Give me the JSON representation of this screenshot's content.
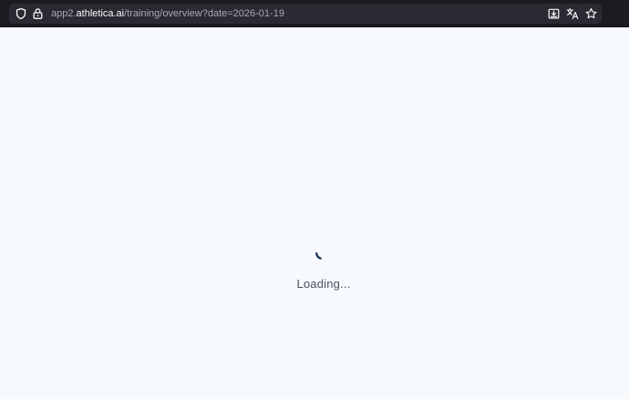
{
  "browser": {
    "url": {
      "prefix": "app2.",
      "host_bold": "athletica.ai",
      "path": "/training/overview?date=2026-01-19"
    },
    "icons": {
      "left": [
        "shield-icon",
        "lock-icon"
      ],
      "right": [
        "download-icon",
        "translate-icon",
        "bookmark-star-icon"
      ]
    }
  },
  "page": {
    "loading_text": "Loading..."
  },
  "colors": {
    "toolbar_bg": "#1c1b22",
    "urlbar_bg": "#2b2a33",
    "page_bg": "#f6fafd",
    "spinner": "#1f3a5a",
    "loading_text": "#4a5260"
  }
}
